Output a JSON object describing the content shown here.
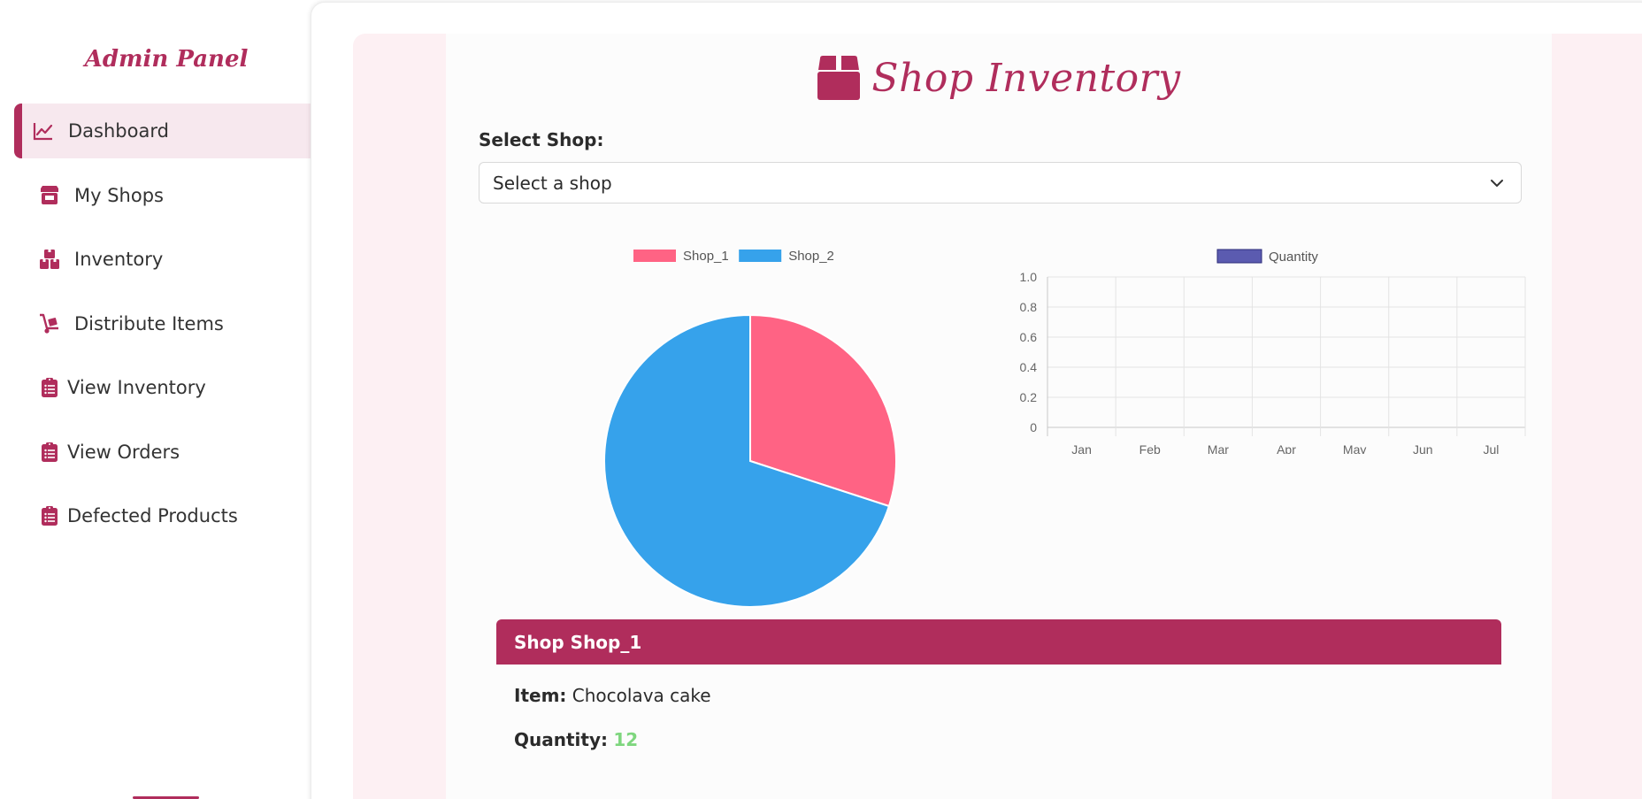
{
  "sidebar": {
    "brand": "Admin Panel",
    "items": [
      {
        "label": "Dashboard",
        "icon": "chart-line-icon",
        "active": true
      },
      {
        "label": "My Shops",
        "icon": "store-icon",
        "active": false
      },
      {
        "label": "Inventory",
        "icon": "boxes-icon",
        "active": false
      },
      {
        "label": "Distribute Items",
        "icon": "dolly-icon",
        "active": false
      },
      {
        "label": "View Inventory",
        "icon": "clipboard-list-icon",
        "active": false
      },
      {
        "label": "View Orders",
        "icon": "clipboard-list-icon",
        "active": false
      },
      {
        "label": "Defected Products",
        "icon": "clipboard-list-icon",
        "active": false
      }
    ]
  },
  "main": {
    "title": "Shop Inventory",
    "title_icon": "box-icon",
    "select_label": "Select Shop:",
    "select_value": "Select a shop"
  },
  "colors": {
    "accent": "#b02d5c",
    "pie_shop1": "#ff6384",
    "pie_shop2": "#36a2eb",
    "bar_fill": "#5b5bb0",
    "quantity_value": "#7ed67e"
  },
  "chart_data": [
    {
      "type": "pie",
      "labels": [
        "Shop_1",
        "Shop_2"
      ],
      "values": [
        30,
        70
      ],
      "legend": "top"
    },
    {
      "type": "bar",
      "categories": [
        "Jan",
        "Feb",
        "Mar",
        "Apr",
        "May",
        "Jun",
        "Jul"
      ],
      "series": [
        {
          "name": "Quantity",
          "values": [
            0,
            0,
            0,
            0,
            0,
            0,
            0
          ]
        }
      ],
      "yticks": [
        "1.0",
        "0.8",
        "0.6",
        "0.4",
        "0.2",
        "0"
      ],
      "ylim": [
        0,
        1
      ],
      "grid": true,
      "legend": "top"
    }
  ],
  "shop_card": {
    "header": "Shop Shop_1",
    "item_label": "Item:",
    "item_value": "Chocolava cake",
    "quantity_label": "Quantity:",
    "quantity_value": "12"
  }
}
